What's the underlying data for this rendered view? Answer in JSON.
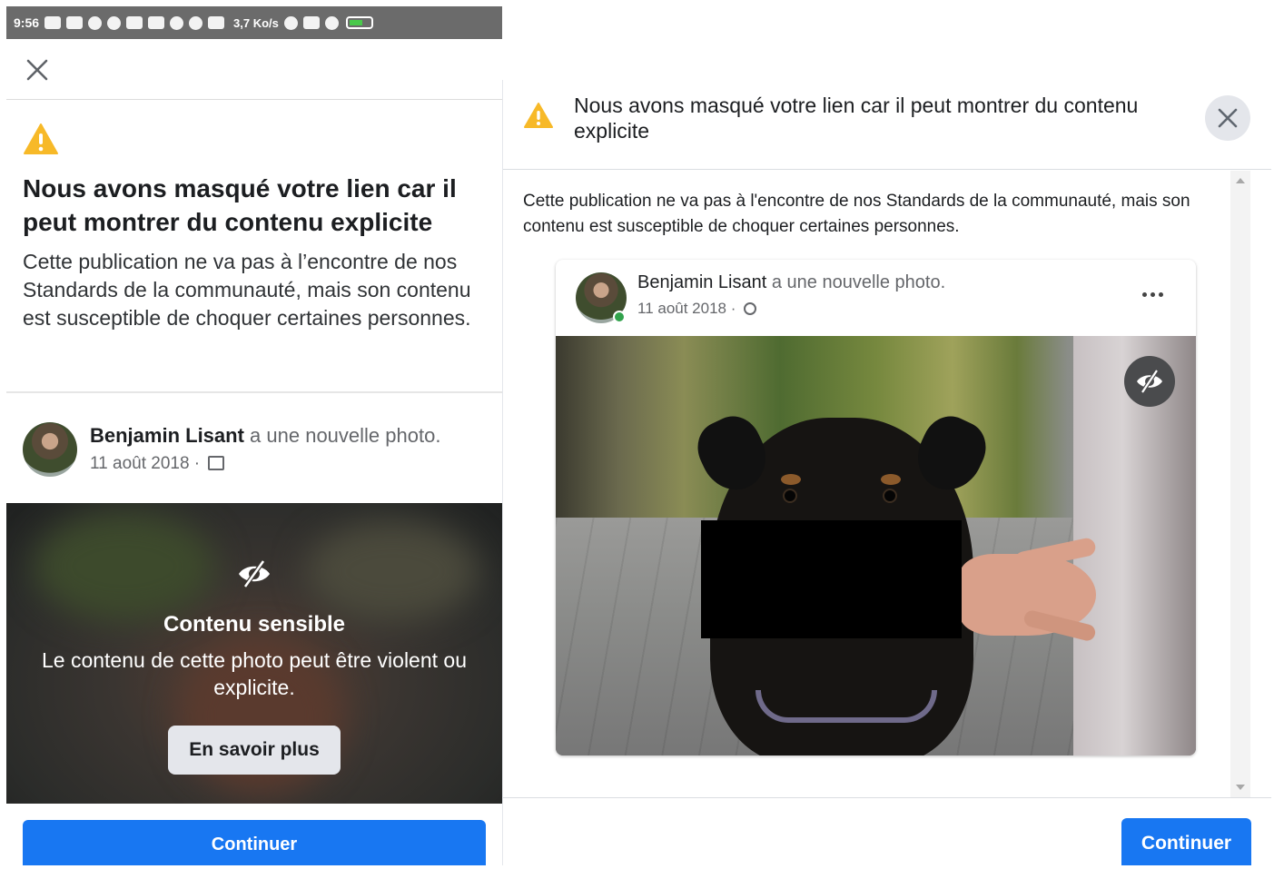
{
  "mobile": {
    "status_bar": {
      "time": "9:56",
      "speed": "3,7 Ko/s",
      "battery_color": "#49c94b"
    },
    "title": "Nous avons masqué votre lien car il peut montrer du contenu explicite",
    "body": "Cette publication ne va pas à l’encontre de nos Standards de la communauté, mais son contenu est susceptible de choquer certaines personnes.",
    "post": {
      "author": "Benjamin Lisant",
      "action": "a une nouvelle photo.",
      "date": "11 août 2018 ·"
    },
    "sensitive": {
      "title": "Contenu sensible",
      "description": "Le contenu de cette photo peut être violent ou explicite.",
      "learn_more": "En savoir plus"
    },
    "continue_label": "Continuer",
    "icons": {
      "close": "close-icon",
      "warning": "warning-icon",
      "eye_slash": "eye-slash-icon",
      "audience": "friends-icon"
    }
  },
  "desktop": {
    "title": "Nous avons masqué votre lien car il peut montrer du contenu explicite",
    "body": "Cette publication ne va pas à l'encontre de nos Standards de la communauté, mais son contenu est susceptible de choquer certaines personnes.",
    "post": {
      "author": "Benjamin Lisant",
      "action": "a une nouvelle photo.",
      "date": "11 août 2018 ·"
    },
    "continue_label": "Continuer",
    "icons": {
      "close": "close-icon",
      "warning": "warning-icon",
      "eye_slash": "eye-slash-icon",
      "more": "more-icon",
      "audience": "public-icon"
    }
  },
  "colors": {
    "accent": "#1877f2",
    "warning": "#f7b928",
    "online": "#31a24c"
  }
}
